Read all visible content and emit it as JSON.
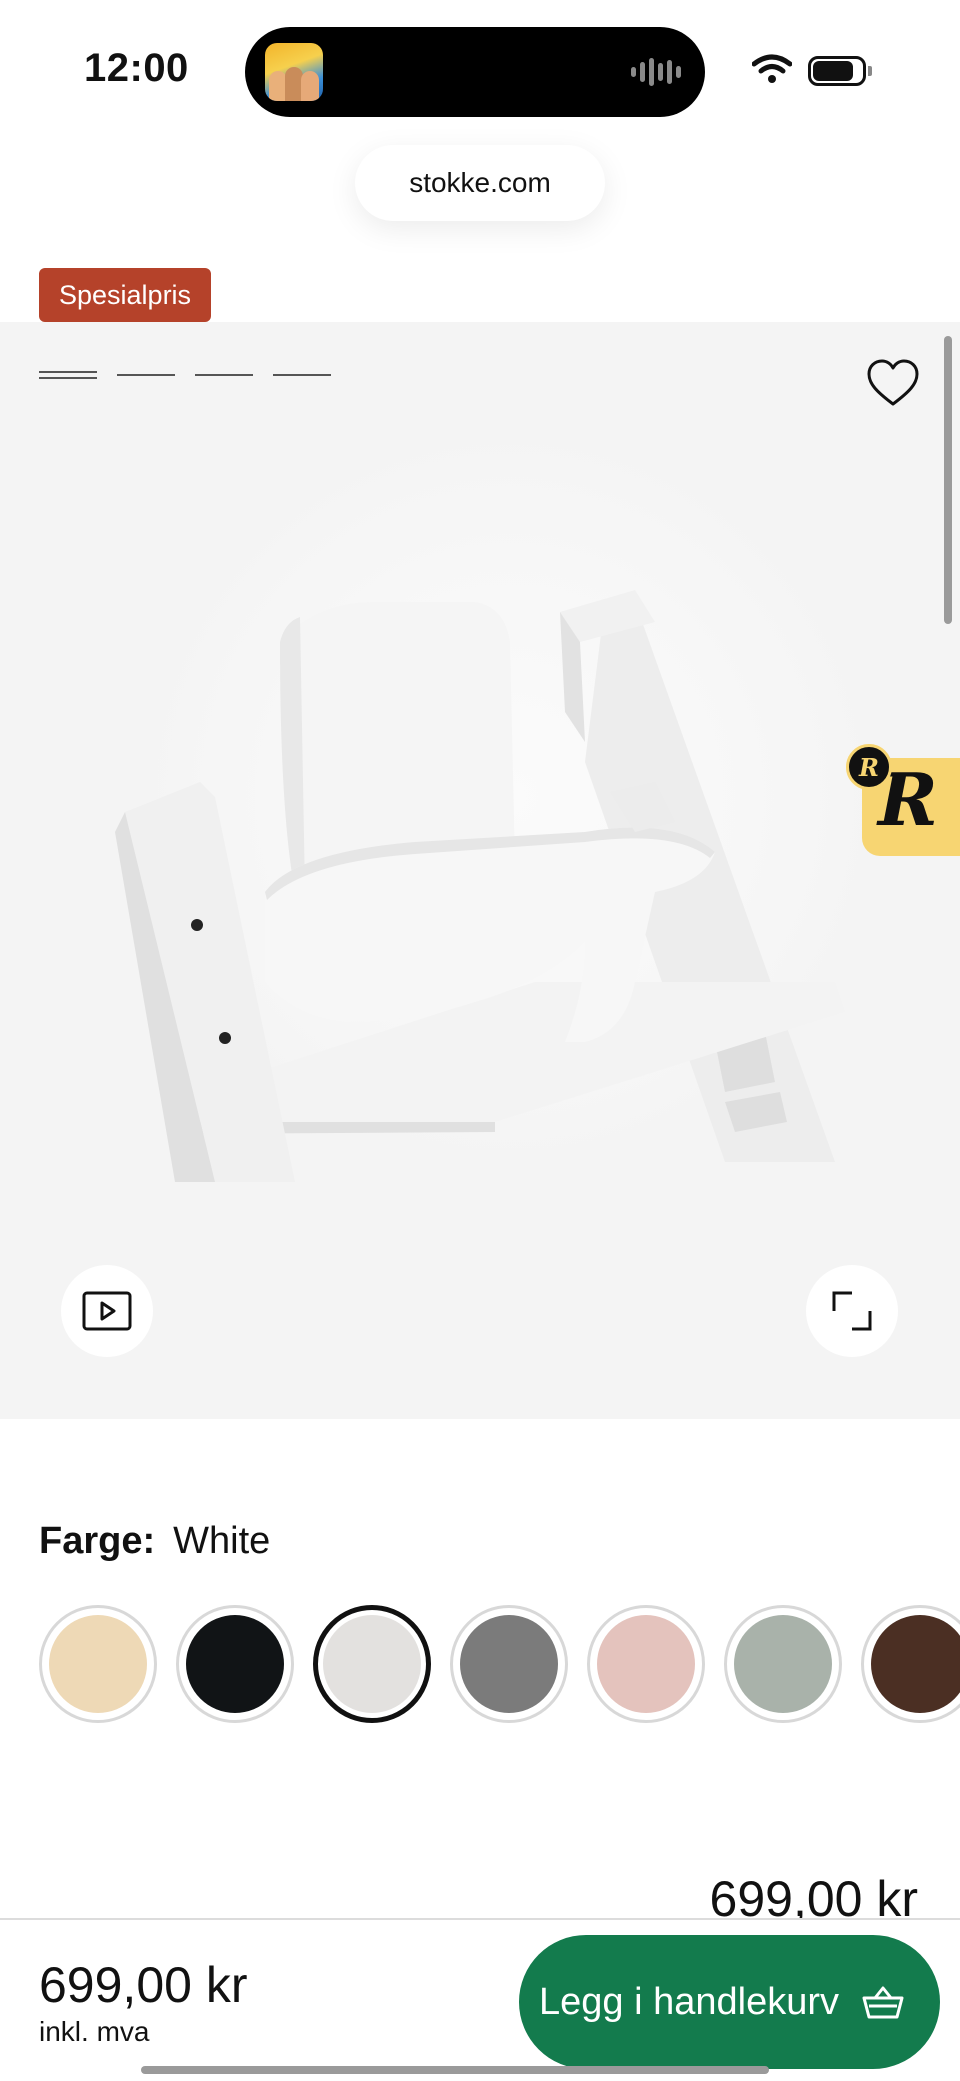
{
  "status_bar": {
    "time": "12:00"
  },
  "browser": {
    "url": "stokke.com"
  },
  "product": {
    "badge": "Spesialpris",
    "gallery": {
      "image_count": 4,
      "active_image": 1
    }
  },
  "floating_widget": {
    "letter": "R"
  },
  "color": {
    "label": "Farge:",
    "selected_value": "White",
    "swatches": [
      {
        "color": "#eed9b6"
      },
      {
        "color": "#111416"
      },
      {
        "color": "#e3e1df",
        "selected": true
      },
      {
        "color": "#7b7b7b"
      },
      {
        "color": "#e4c3bd"
      },
      {
        "color": "#a9b2aa"
      },
      {
        "color": "#4b2f23"
      }
    ]
  },
  "price_display": "699,00 kr",
  "bottom_bar": {
    "price": "699,00 kr",
    "vat_note": "inkl. mva",
    "add_to_cart_label": "Legg i handlekurv"
  },
  "colors": {
    "badge": "#b5422a",
    "cart_button": "#137b4d",
    "widget": "#f7d572"
  }
}
